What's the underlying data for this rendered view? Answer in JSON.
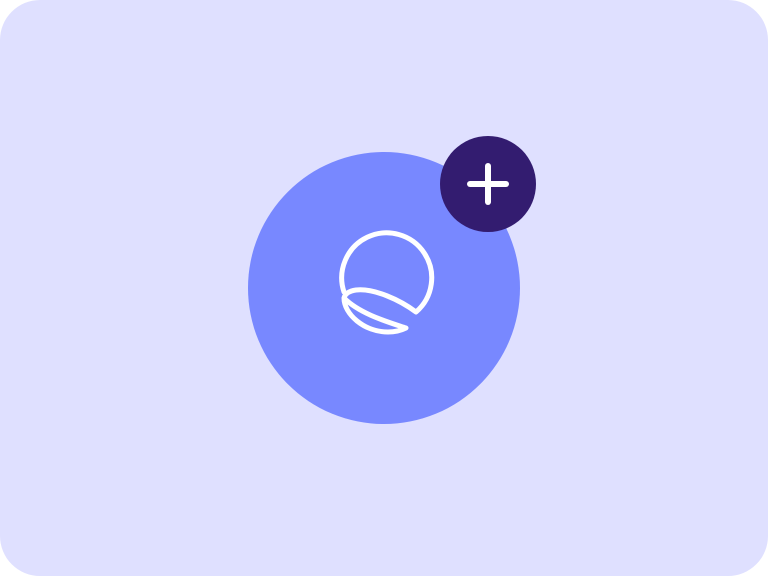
{
  "colors": {
    "background": "#dfe0ff",
    "app_circle": "#7888ff",
    "badge": "#331c70",
    "icon_stroke": "#ffffff"
  },
  "app_icon": {
    "icon": "sunset-logo-icon"
  },
  "add_badge": {
    "icon": "plus-icon"
  }
}
